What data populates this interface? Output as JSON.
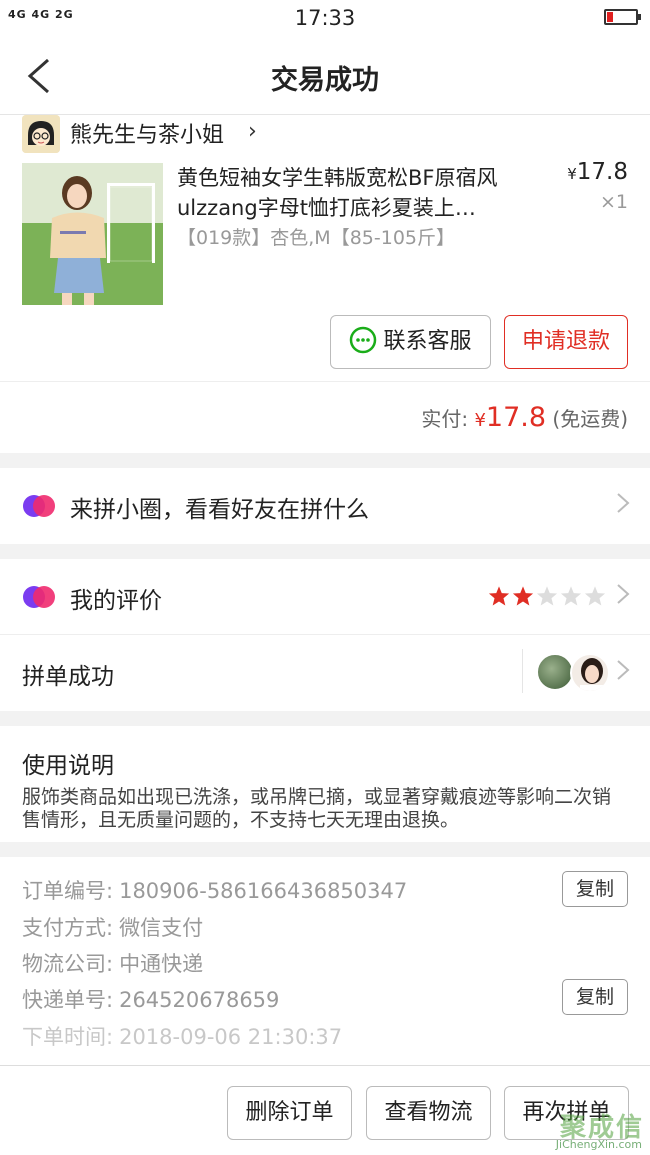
{
  "status_bar": {
    "signal": "4G 4G  2G",
    "time": "17:33"
  },
  "nav": {
    "title": "交易成功"
  },
  "store": {
    "name": "熊先生与茶小姐"
  },
  "product": {
    "title": "黄色短袖女学生韩版宽松BF原宿风ulzzang字母t恤打底衫夏装上…",
    "spec": "【019款】杏色,M【85-105斤】",
    "currency": "¥",
    "price": "17.8",
    "qty": "×1"
  },
  "actions": {
    "contact": "联系客服",
    "refund": "申请退款"
  },
  "paid": {
    "label": "实付:",
    "currency": "¥",
    "amount": "17.8",
    "note": "(免运费)"
  },
  "circle": {
    "label": "来拼小圈，看看好友在拼什么"
  },
  "review": {
    "label": "我的评价",
    "rating": 2,
    "max": 5
  },
  "group": {
    "label": "拼单成功"
  },
  "rules": {
    "title": "使用说明",
    "text": "服饰类商品如出现已洗涤，或吊牌已摘，或显著穿戴痕迹等影响二次销售情形，且无质量问题的，不支持七天无理由退换。"
  },
  "order": {
    "number_label": "订单编号:",
    "number": "180906-586166436850347",
    "pay_label": "支付方式:",
    "pay": "微信支付",
    "carrier_label": "物流公司:",
    "carrier": "中通快递",
    "tracking_label": "快递单号:",
    "tracking": "264520678659",
    "time_label": "下单时间:",
    "time": "2018-09-06 21:30:37",
    "copy": "复制"
  },
  "footer": {
    "delete": "删除订单",
    "logistics": "查看物流",
    "again": "再次拼单"
  },
  "watermark": {
    "cn": "聚成信",
    "en": "JiChengXin.com"
  },
  "colors": {
    "accent": "#e02e24",
    "star_on": "#e02e24",
    "star_off": "#dddddd"
  }
}
